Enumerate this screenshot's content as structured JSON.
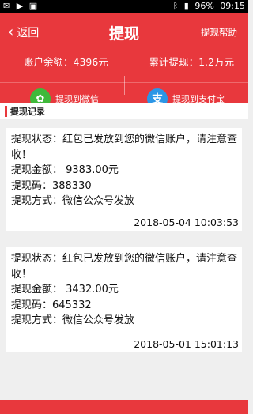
{
  "status_bar": {
    "left_icons": [
      "notification-icon",
      "video-icon",
      "image-icon"
    ],
    "battery": "96%",
    "time": "09:15"
  },
  "header": {
    "back_label": "返回",
    "title": "提现",
    "help_label": "提现帮助",
    "balance_label": "账户余额：4396元",
    "total_label": "累计提现：1.2万元",
    "wechat_label": "提现到微信",
    "alipay_label": "提现到支付宝"
  },
  "records_title": "提现记录",
  "records": [
    {
      "status_line": "提现状态：红包已发放到您的微信账户，请注意查收！",
      "amount_line": "提现金额： 9383.00元",
      "code_line": "提现码：388330",
      "method_line": "提现方式：微信公众号发放",
      "time": "2018-05-04 10:03:53"
    },
    {
      "status_line": "提现状态：红包已发放到您的微信账户，请注意查收！",
      "amount_line": "提现金额： 3432.00元",
      "code_line": "提现码：645332",
      "method_line": "提现方式：微信公众号发放",
      "time": "2018-05-01 15:01:13"
    }
  ],
  "colors": {
    "brand": "#e8383d",
    "wechat": "#3fb93a",
    "alipay": "#2b96e6"
  }
}
